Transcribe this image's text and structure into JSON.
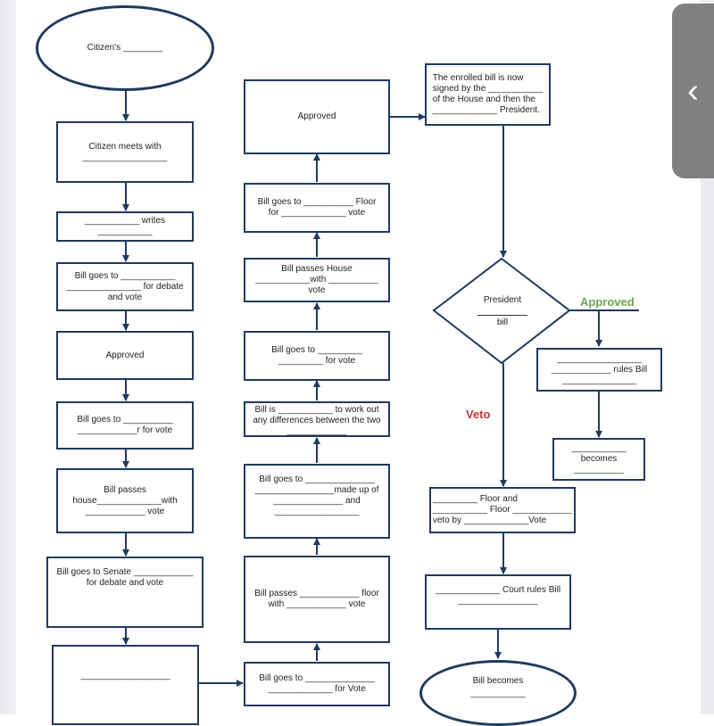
{
  "colors": {
    "stroke": "#1f3a5f",
    "approved": "#6aa84f",
    "veto": "#cc3333",
    "back_tab": "#808080"
  },
  "nodes": {
    "start": "Citizen's ________",
    "c1_1": "Citizen meets with\n_________________",
    "c1_2": "___________ writes\n___________",
    "c1_3": "Bill goes to ___________\n_______________ for debate\nand vote",
    "c1_4": "Approved",
    "c1_5": "Bill goes to __________\n____________r for vote",
    "c1_6": "Bill passes\nhouse_____________with\n____________ vote",
    "c1_7": "Bill goes to Senate ____________\nfor debate and vote",
    "c1_8": "__________________",
    "c2_1": "Bill goes to ______________\n_____________ for Vote",
    "c2_2": "Bill passes ____________ floor\nwith ____________ vote",
    "c2_3": "Bill goes to ______________\n________________made up of\n______________ and\n_________________",
    "c2_4": "Bill is ___________ to work out\nany differences between the two\n____________",
    "c2_5": "Bill goes to _________\n_________ for vote",
    "c2_6": "Bill passes House\n___________with __________\nvote",
    "c2_7": "Bill goes to __________ Floor\nfor _____________ vote",
    "c2_8": "Approved",
    "c3_1": "The enrolled bill is now\nsigned by the ___________\nof the House and then the\n_____________ President.",
    "diamond_title": "President",
    "diamond_sub": "bill",
    "approved_label": "Approved",
    "veto_label": "Veto",
    "r_rules": "_________________\n____________ rules Bill\n_______________",
    "r_becomes": "___________\nbecomes\n__________",
    "v_floor": "_________ Floor and\n___________ Floor ____________\nveto by _____________Vote",
    "court": "_____________ Court rules Bill\n________________",
    "end": "Bill becomes\n___________"
  },
  "ui": {
    "back_icon": "‹"
  }
}
